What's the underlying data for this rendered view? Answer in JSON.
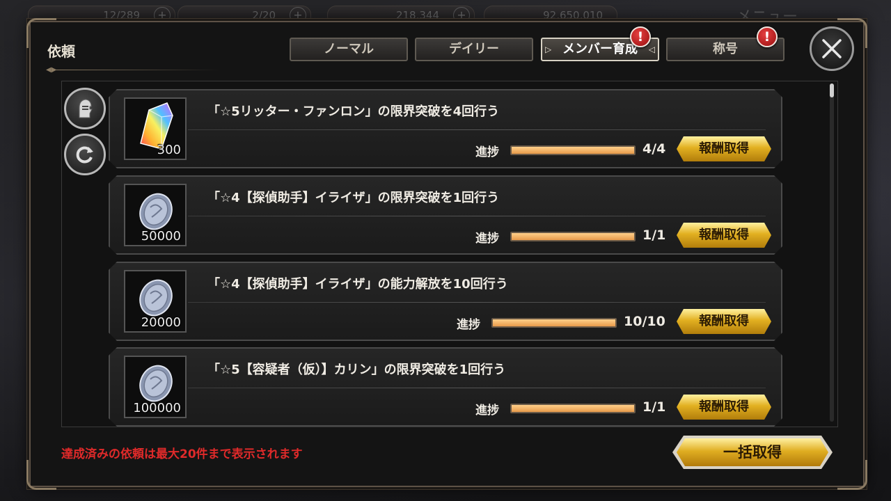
{
  "top_bar": {
    "ap_value": "12/289",
    "bp_value": "2/20",
    "gems_value": "218,344",
    "coins_value": "92,650,010",
    "menu_label": "メニュー"
  },
  "panel": {
    "title": "依頼",
    "tabs": [
      {
        "label": "ノーマル",
        "active": false,
        "alert": false
      },
      {
        "label": "デイリー",
        "active": false,
        "alert": false
      },
      {
        "label": "メンバー育成",
        "active": true,
        "alert": true
      },
      {
        "label": "称号",
        "active": false,
        "alert": true
      }
    ],
    "alert_symbol": "!",
    "close_icon": "close-x-icon"
  },
  "side_buttons": [
    {
      "icon": "knight-helmet-icon"
    },
    {
      "icon": "refresh-icon"
    }
  ],
  "quests": [
    {
      "text": "「☆5リッター・ファンロン」の限界突破を4回行う",
      "reward_icon": "rainbow-crystal-icon",
      "reward_qty": "300",
      "progress_label": "進捗",
      "progress_value": "4/4",
      "progress_fraction": 1.0,
      "claim_label": "報酬取得"
    },
    {
      "text": "「☆4【探偵助手】イライザ」の限界突破を1回行う",
      "reward_icon": "silver-coin-icon",
      "reward_qty": "50000",
      "progress_label": "進捗",
      "progress_value": "1/1",
      "progress_fraction": 1.0,
      "claim_label": "報酬取得"
    },
    {
      "text": "「☆4【探偵助手】イライザ」の能力解放を10回行う",
      "reward_icon": "silver-coin-icon",
      "reward_qty": "20000",
      "progress_label": "進捗",
      "progress_value": "10/10",
      "progress_fraction": 1.0,
      "claim_label": "報酬取得"
    },
    {
      "text": "「☆5【容疑者（仮）】カリン」の限界突破を1回行う",
      "reward_icon": "silver-coin-icon",
      "reward_qty": "100000",
      "progress_label": "進捗",
      "progress_value": "1/1",
      "progress_fraction": 1.0,
      "claim_label": "報酬取得"
    }
  ],
  "footer": {
    "note": "達成済みの依頼は最大20件まで表示されます",
    "bulk_claim_label": "一括取得"
  },
  "colors": {
    "accent_gold": "#e2b021",
    "note_red": "#e02a2a",
    "progress_fill": "#f0b060",
    "alert_red": "#c8181a"
  }
}
